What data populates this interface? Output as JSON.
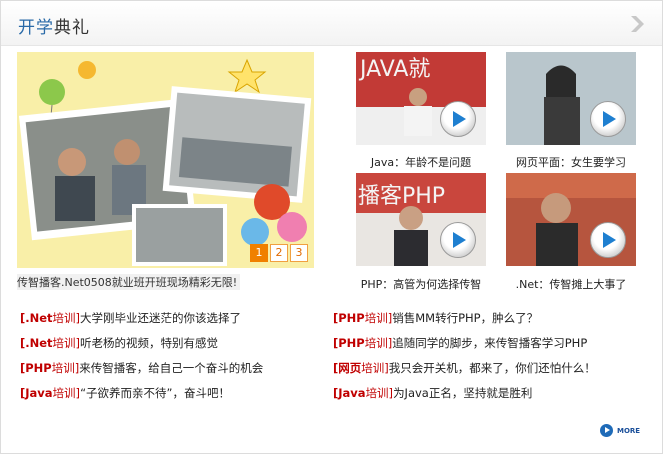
{
  "header": {
    "title_part1": "开学",
    "title_part2": "典礼",
    "more_icon": "chevron-right-icon"
  },
  "banner": {
    "caption": "传智播客.Net0508就业班开班现场精彩无限!",
    "pages": [
      "1",
      "2",
      "3"
    ],
    "active_page": "1"
  },
  "videos": [
    {
      "caption": "Java：年龄不是问题",
      "screen_text": "JAVA就",
      "bg": "#c23a36"
    },
    {
      "caption": "网页平面：女生要学习",
      "screen_text": "",
      "bg": "#b9c6cc"
    },
    {
      "caption": "PHP：高管为何选择传智",
      "screen_text": "播客PHP",
      "bg": "#c9463d"
    },
    {
      "caption": ".Net：传智摊上大事了",
      "screen_text": "",
      "bg": "#b6553e"
    }
  ],
  "news_left": [
    {
      "tag": "[.Net",
      "tag2": "培训]",
      "text": "大学刚毕业还迷茫的你该选择了"
    },
    {
      "tag": "[.Net",
      "tag2": "培训]",
      "text": "听老杨的视频，特别有感觉"
    },
    {
      "tag": "[PHP",
      "tag2": "培训]",
      "text": "来传智播客，给自己一个奋斗的机会"
    },
    {
      "tag": "[Java",
      "tag2": "培训]",
      "text": "“子欲养而亲不待”，奋斗吧！"
    }
  ],
  "news_right": [
    {
      "tag": "[PHP",
      "tag2": "培训]",
      "text": "销售MM转行PHP，肿么了？"
    },
    {
      "tag": "[PHP",
      "tag2": "培训]",
      "text": "追随同学的脚步，来传智播客学习PHP"
    },
    {
      "tag": "[网页",
      "tag2": "培训]",
      "text": "我只会开关机，都来了，你们还怕什么！"
    },
    {
      "tag": "[Java",
      "tag2": "培训]",
      "text": "为Java正名，坚持就是胜利"
    }
  ],
  "more": {
    "label": "MORE"
  }
}
